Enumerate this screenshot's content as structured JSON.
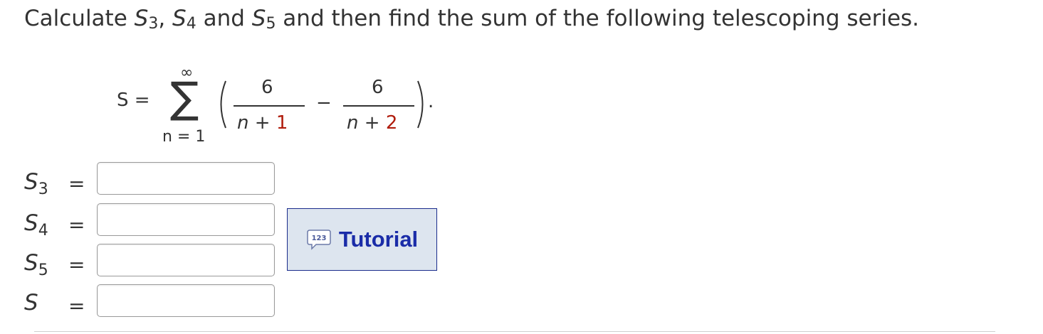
{
  "question": {
    "part1": "Calculate ",
    "s3_base": "S",
    "s3_sub": "3",
    "sep1": ", ",
    "s4_base": "S",
    "s4_sub": "4",
    "sep2": " and ",
    "s5_base": "S",
    "s5_sub": "5",
    "part2": " and then find the sum of the following telescoping series."
  },
  "formula": {
    "lhs": "S =",
    "upper_limit": "∞",
    "sigma": "∑",
    "lower_limit": "n = 1",
    "numerator1": "6",
    "denominator1_var": "n",
    "denominator1_op": "+",
    "denominator1_const": "1",
    "minus": "−",
    "numerator2": "6",
    "denominator2_var": "n",
    "denominator2_op": "+",
    "denominator2_const": "2",
    "period": "."
  },
  "answers": [
    {
      "label": "S",
      "sub": "3",
      "equals": "=",
      "value": ""
    },
    {
      "label": "S",
      "sub": "4",
      "equals": "=",
      "value": ""
    },
    {
      "label": "S",
      "sub": "5",
      "equals": "=",
      "value": ""
    },
    {
      "label": "S",
      "sub": "",
      "equals": "=",
      "value": ""
    }
  ],
  "tutorial": {
    "label": "Tutorial",
    "icon_text": "123",
    "icon": "speech-bubble-icon"
  },
  "colors": {
    "accent": "#1a2ca8",
    "constant_red": "#b01c0c",
    "button_bg": "#dde5ef"
  }
}
